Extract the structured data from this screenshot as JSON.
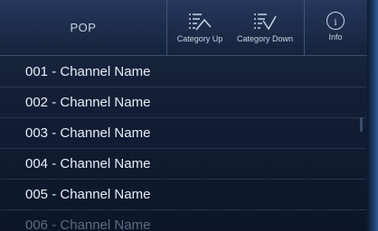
{
  "header": {
    "category": "POP",
    "buttons": {
      "category_up": "Category Up",
      "category_down": "Category Down",
      "info": "Info"
    }
  },
  "channels": [
    {
      "label": "001 -  Channel Name"
    },
    {
      "label": "002 -  Channel Name"
    },
    {
      "label": "003 -  Channel Name"
    },
    {
      "label": "004 -  Channel Name"
    },
    {
      "label": "005 -  Channel Name"
    },
    {
      "label": "006 -  Channel Name"
    }
  ],
  "icons": {
    "category_up": "list-arrow-up-icon",
    "category_down": "list-arrow-down-icon",
    "info": "info-icon"
  },
  "colors": {
    "background": "#132038",
    "text": "#e8eef8",
    "accent": "#2d5c98"
  }
}
